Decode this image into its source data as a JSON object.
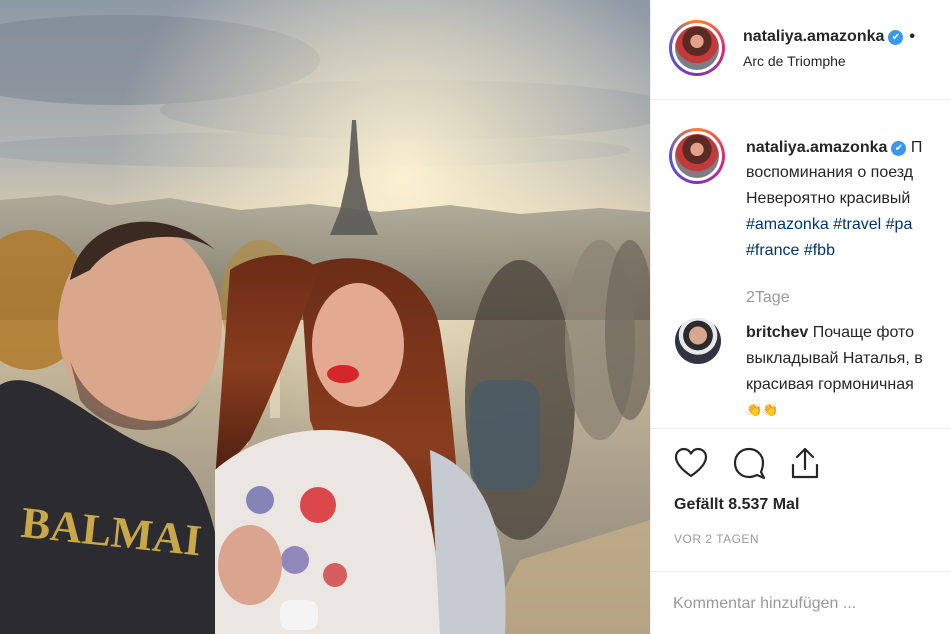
{
  "post": {
    "username": "nataliya.amazonka",
    "verified_mark": "✔",
    "dot": "•",
    "location": "Arc de Triomphe"
  },
  "caption": {
    "username": "nataliya.amazonka",
    "line1_tail": "П",
    "line2": "воспоминания о поезд",
    "line3": "Невероятно красивый",
    "tags_line1": [
      "#amazonka",
      "#travel",
      "#pa"
    ],
    "tags_line2": [
      "#france",
      "#fbb"
    ],
    "time": "2Tage"
  },
  "comment": {
    "username": "britchev",
    "line1": "Почаще фото",
    "line2": "выкладывай Наталья, в",
    "line3": "красивая гормоничная",
    "emoji": "👏👏"
  },
  "actions": {
    "like_icon": "heart-icon",
    "comment_icon": "speech-bubble-icon",
    "share_icon": "share-icon",
    "likes_text": "Gefällt 8.537 Mal",
    "ago_text": "VOR 2 TAGEN"
  },
  "comment_input": {
    "placeholder": "Kommentar hinzufügen ..."
  },
  "photo": {
    "image_icon": "photo-of-couple-selfie-with-eiffel-tower"
  },
  "colors": {
    "link_blue": "#003569",
    "verified_blue": "#3897f0",
    "muted_gray": "#999999",
    "border": "#efefef"
  }
}
